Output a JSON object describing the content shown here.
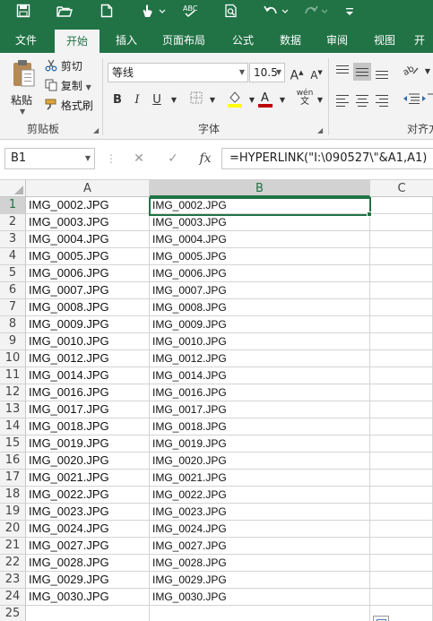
{
  "quick_access": {
    "icons": [
      "save-icon",
      "open-folder-icon",
      "new-file-icon",
      "touch-mode-icon",
      "spelling-icon",
      "print-preview-icon",
      "undo-icon",
      "redo-icon",
      "customize-icon"
    ]
  },
  "tabs": [
    "文件",
    "开始",
    "插入",
    "页面布局",
    "公式",
    "数据",
    "审阅",
    "视图",
    "开"
  ],
  "active_tab": "开始",
  "clipboard": {
    "paste_label": "粘贴",
    "cut_label": "剪切",
    "copy_label": "复制",
    "format_painter_label": "格式刷",
    "group_label": "剪贴板"
  },
  "font": {
    "name": "等线",
    "size": "10.5",
    "bold": "B",
    "italic": "I",
    "underline": "U",
    "grow": "A",
    "shrink": "A",
    "phonetic": "wén",
    "group_label": "字体"
  },
  "alignment": {
    "group_label": "对齐方"
  },
  "formula_bar": {
    "name_box": "B1",
    "cancel": "✕",
    "enter": "✓",
    "fx": "fx",
    "formula": "=HYPERLINK(\"I:\\090527\\\"&A1,A1)"
  },
  "sheet": {
    "columns": [
      "A",
      "B",
      "C"
    ],
    "selected_cell": "B1",
    "rows": [
      {
        "n": "1",
        "a": "IMG_0002.JPG",
        "b": "IMG_0002.JPG"
      },
      {
        "n": "2",
        "a": "IMG_0003.JPG",
        "b": "IMG_0003.JPG"
      },
      {
        "n": "3",
        "a": "IMG_0004.JPG",
        "b": "IMG_0004.JPG"
      },
      {
        "n": "4",
        "a": "IMG_0005.JPG",
        "b": "IMG_0005.JPG"
      },
      {
        "n": "5",
        "a": "IMG_0006.JPG",
        "b": "IMG_0006.JPG"
      },
      {
        "n": "6",
        "a": "IMG_0007.JPG",
        "b": "IMG_0007.JPG"
      },
      {
        "n": "7",
        "a": "IMG_0008.JPG",
        "b": "IMG_0008.JPG"
      },
      {
        "n": "8",
        "a": "IMG_0009.JPG",
        "b": "IMG_0009.JPG"
      },
      {
        "n": "9",
        "a": "IMG_0010.JPG",
        "b": "IMG_0010.JPG"
      },
      {
        "n": "10",
        "a": "IMG_0012.JPG",
        "b": "IMG_0012.JPG"
      },
      {
        "n": "11",
        "a": "IMG_0014.JPG",
        "b": "IMG_0014.JPG"
      },
      {
        "n": "12",
        "a": "IMG_0016.JPG",
        "b": "IMG_0016.JPG"
      },
      {
        "n": "13",
        "a": "IMG_0017.JPG",
        "b": "IMG_0017.JPG"
      },
      {
        "n": "14",
        "a": "IMG_0018.JPG",
        "b": "IMG_0018.JPG"
      },
      {
        "n": "15",
        "a": "IMG_0019.JPG",
        "b": "IMG_0019.JPG"
      },
      {
        "n": "16",
        "a": "IMG_0020.JPG",
        "b": "IMG_0020.JPG"
      },
      {
        "n": "17",
        "a": "IMG_0021.JPG",
        "b": "IMG_0021.JPG"
      },
      {
        "n": "18",
        "a": "IMG_0022.JPG",
        "b": "IMG_0022.JPG"
      },
      {
        "n": "19",
        "a": "IMG_0023.JPG",
        "b": "IMG_0023.JPG"
      },
      {
        "n": "20",
        "a": "IMG_0024.JPG",
        "b": "IMG_0024.JPG"
      },
      {
        "n": "21",
        "a": "IMG_0027.JPG",
        "b": "IMG_0027.JPG"
      },
      {
        "n": "22",
        "a": "IMG_0028.JPG",
        "b": "IMG_0028.JPG"
      },
      {
        "n": "23",
        "a": "IMG_0029.JPG",
        "b": "IMG_0029.JPG"
      },
      {
        "n": "24",
        "a": "IMG_0030.JPG",
        "b": "IMG_0030.JPG"
      },
      {
        "n": "25",
        "a": "",
        "b": ""
      }
    ]
  },
  "colors": {
    "brand": "#217346",
    "font_color": "#c00000",
    "highlight": "#ffff00"
  }
}
